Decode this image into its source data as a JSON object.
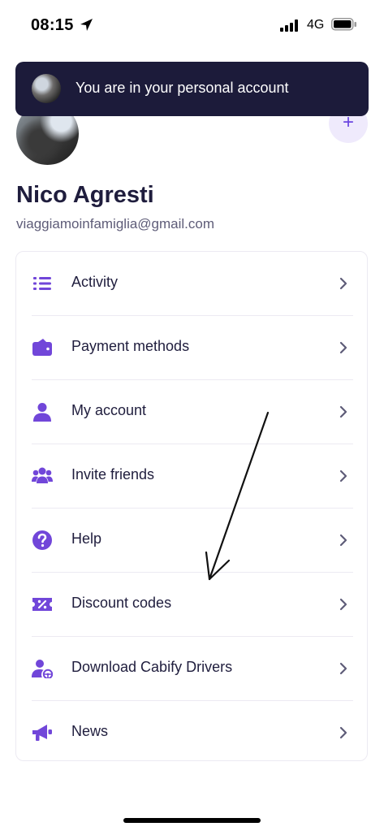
{
  "status_bar": {
    "time": "08:15",
    "network": "4G"
  },
  "toast": {
    "message": "You are in your personal account"
  },
  "profile": {
    "name": "Nico Agresti",
    "email": "viaggiamoinfamiglia@gmail.com",
    "add_button_label": "+"
  },
  "menu": {
    "items": [
      {
        "label": "Activity",
        "icon": "list-icon"
      },
      {
        "label": "Payment methods",
        "icon": "wallet-icon"
      },
      {
        "label": "My account",
        "icon": "person-icon"
      },
      {
        "label": "Invite friends",
        "icon": "group-icon"
      },
      {
        "label": "Help",
        "icon": "question-icon"
      },
      {
        "label": "Discount codes",
        "icon": "coupon-icon"
      },
      {
        "label": "Download Cabify Drivers",
        "icon": "driver-icon"
      },
      {
        "label": "News",
        "icon": "megaphone-icon"
      }
    ]
  },
  "colors": {
    "accent": "#7146d9",
    "toast_bg": "#1c1b3a",
    "text": "#1f1d3d",
    "muted": "#5e5c78",
    "divider": "#eceaf2"
  }
}
